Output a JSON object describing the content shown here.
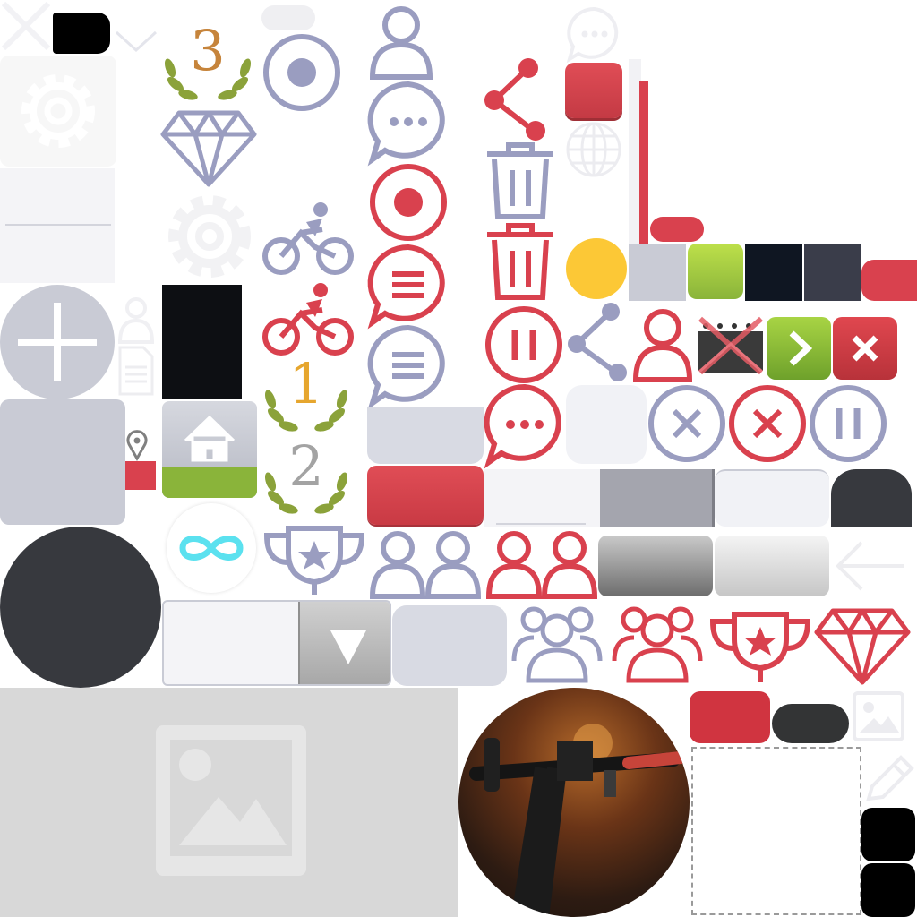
{
  "sheet": {
    "colors": {
      "red": "#d9414e",
      "lavender": "#9a9dc0",
      "dark": "#37393e",
      "green": "#8ab43a",
      "yellow": "#fcc836",
      "placeholder_gray": "#d8d8d8",
      "light_gray": "#c9cbd5"
    },
    "icons": [
      "close-icon",
      "gear-icon",
      "chevron-down-icon",
      "laurel-icon",
      "diamond-icon",
      "radio-selected-icon",
      "user-icon",
      "chat-bubble-icon",
      "record-icon",
      "cycling-icon",
      "share-icon",
      "trash-icon",
      "globe-icon",
      "plus-icon",
      "document-icon",
      "location-pin-icon",
      "home-icon",
      "infinity-icon",
      "trophy-icon",
      "pause-icon",
      "cancel-icon",
      "chevron-right-icon",
      "group-icon",
      "back-arrow-icon",
      "image-icon",
      "pencil-icon",
      "dropdown-arrow-icon",
      "video-off-icon"
    ],
    "ranks": {
      "first": "1",
      "second": "2",
      "third": "3"
    },
    "photo_description_icon": "bicycle-handlebar-photo"
  }
}
